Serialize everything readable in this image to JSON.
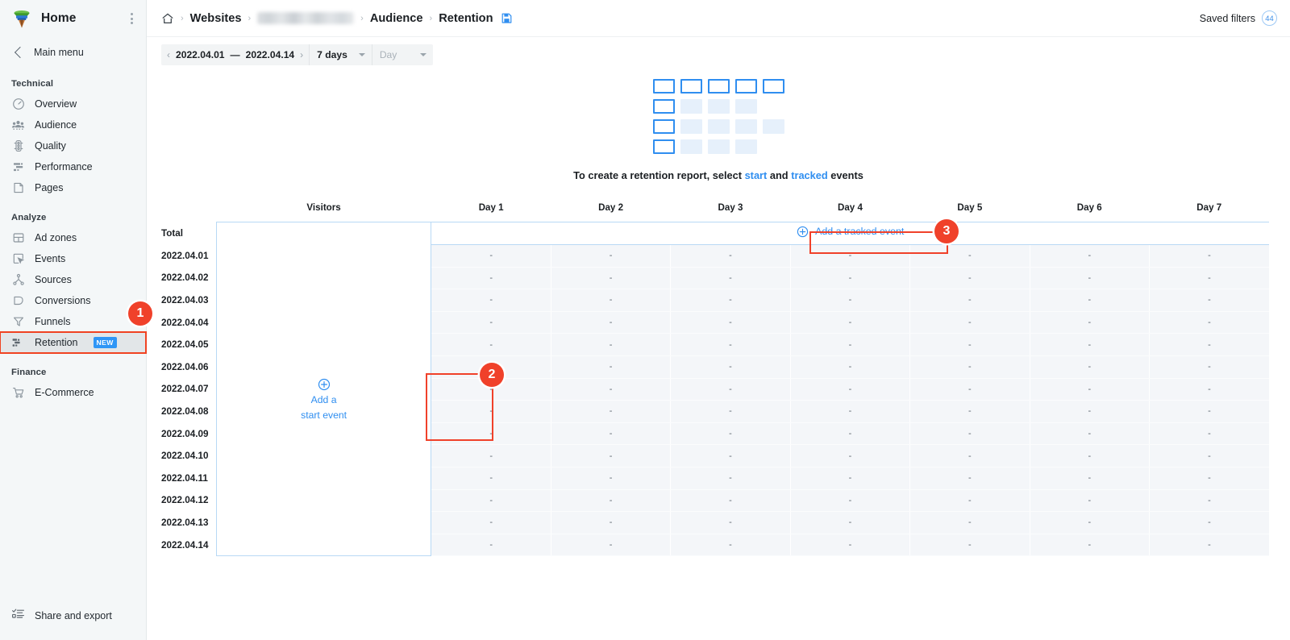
{
  "sidebar": {
    "logo_icon": "funnel-logo-icon",
    "title": "Home",
    "kebab_icon": "kebab-menu-icon",
    "main_menu": {
      "label": "Main menu",
      "icon": "chevron-left-icon"
    },
    "sections": [
      {
        "label": "Technical",
        "items": [
          {
            "label": "Overview",
            "icon": "gauge-icon"
          },
          {
            "label": "Audience",
            "icon": "people-icon"
          },
          {
            "label": "Quality",
            "icon": "traffic-light-icon"
          },
          {
            "label": "Performance",
            "icon": "bars-icon"
          },
          {
            "label": "Pages",
            "icon": "page-icon"
          }
        ]
      },
      {
        "label": "Analyze",
        "items": [
          {
            "label": "Ad zones",
            "icon": "layout-icon"
          },
          {
            "label": "Events",
            "icon": "cursor-box-icon"
          },
          {
            "label": "Sources",
            "icon": "tree-icon"
          },
          {
            "label": "Conversions",
            "icon": "conversion-icon"
          },
          {
            "label": "Funnels",
            "icon": "funnel-icon"
          },
          {
            "label": "Retention",
            "icon": "retention-icon",
            "badge": "NEW",
            "active": true
          }
        ]
      },
      {
        "label": "Finance",
        "items": [
          {
            "label": "E-Commerce",
            "icon": "cart-icon"
          }
        ]
      }
    ],
    "footer": {
      "label": "Share and export",
      "icon": "share-export-icon"
    }
  },
  "topbar": {
    "home_icon": "home-icon",
    "breadcrumb": [
      "Websites",
      "████████",
      "Audience",
      "Retention"
    ],
    "breadcrumb_websites": "Websites",
    "breadcrumb_site_masked": "",
    "breadcrumb_audience": "Audience",
    "breadcrumb_retention": "Retention",
    "separator": "›",
    "save_icon": "save-report-icon",
    "saved_filters_label": "Saved filters",
    "saved_filters_count": "44"
  },
  "filters": {
    "prev_icon": "chevron-left-icon",
    "next_icon": "chevron-right-icon",
    "date_from": "2022.04.01",
    "date_dash": "—",
    "date_to": "2022.04.14",
    "period": "7 days",
    "granularity_placeholder": "Day",
    "caret_icon": "chevron-down-icon"
  },
  "empty_state": {
    "illustration_icon": "retention-grid-illustration",
    "text_prefix": "To create a retention report, select",
    "link_start": "start",
    "text_and": "and",
    "link_tracked": "tracked",
    "text_suffix": "events",
    "grid_rows": [
      [
        "o",
        "o",
        "o",
        "o",
        "o"
      ],
      [
        "o",
        "f",
        "f",
        "f"
      ],
      [
        "o",
        "f",
        "f",
        "f",
        "f"
      ],
      [
        "o",
        "f",
        "f",
        "f"
      ]
    ]
  },
  "table": {
    "col_date": "",
    "col_visitors": "Visitors",
    "day_headers": [
      "Day 1",
      "Day 2",
      "Day 3",
      "Day 4",
      "Day 5",
      "Day 6",
      "Day 7"
    ],
    "total_label": "Total",
    "add_tracked_event": "Add a tracked event",
    "add_tracked_icon": "plus-circle-icon",
    "add_start_event_line1": "Add a",
    "add_start_event_line2": "start event",
    "add_start_icon": "plus-circle-icon",
    "empty_cell": "-",
    "rows": [
      "2022.04.01",
      "2022.04.02",
      "2022.04.03",
      "2022.04.04",
      "2022.04.05",
      "2022.04.06",
      "2022.04.07",
      "2022.04.08",
      "2022.04.09",
      "2022.04.10",
      "2022.04.11",
      "2022.04.12",
      "2022.04.13",
      "2022.04.14"
    ]
  },
  "annotations": {
    "marker_1": "1",
    "marker_2": "2",
    "marker_3": "3"
  },
  "colors": {
    "accent_blue": "#2f8ef0",
    "annotation_red": "#f0412a",
    "badge_blue": "#2f96f6",
    "sidebar_bg": "#f4f7f8",
    "cell_bg": "#f4f6f9",
    "border_blue": "#b8d9f5"
  }
}
